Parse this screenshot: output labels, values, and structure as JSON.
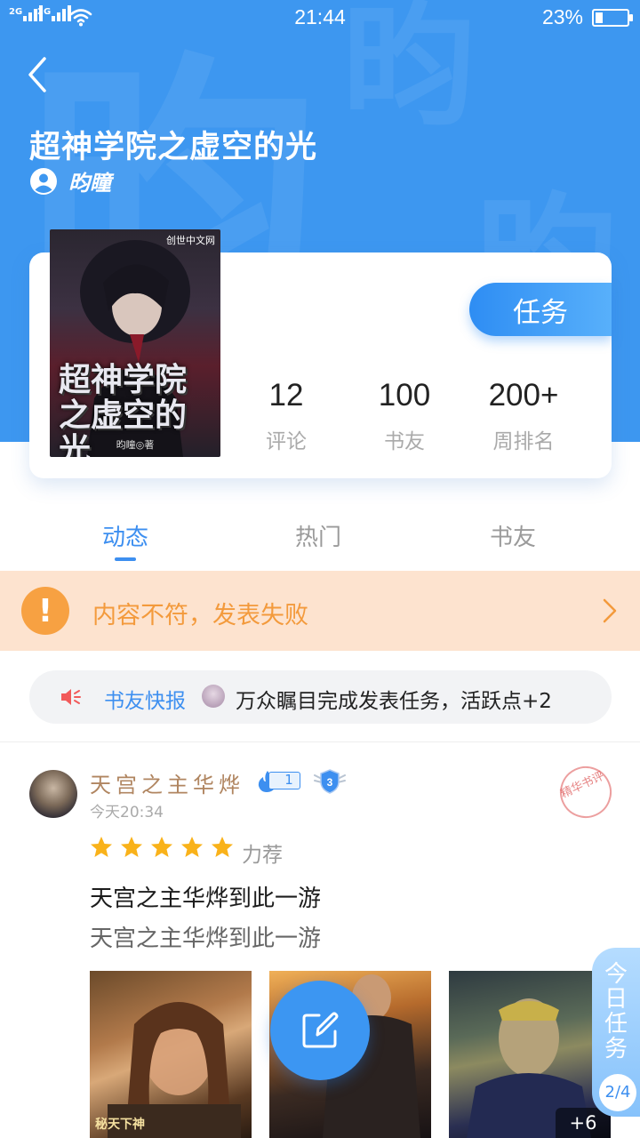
{
  "status_bar": {
    "network_1": "2G",
    "network_2": "2G",
    "time": "21:44",
    "battery_percent": "23%",
    "battery_level": 0.23
  },
  "header": {
    "watermark_char": "昀",
    "title": "超神学院之虚空的光",
    "author": "昀瞳"
  },
  "book_cover": {
    "title": "超神学院之虚空的光",
    "publisher": "创世中文网",
    "author_credit": "昀瞳◎著"
  },
  "task_button": "任务",
  "stats": [
    {
      "value": "12",
      "label": "评论"
    },
    {
      "value": "100",
      "label": "书友"
    },
    {
      "value": "200+",
      "label": "周排名"
    }
  ],
  "tabs": [
    {
      "label": "动态",
      "active": true
    },
    {
      "label": "热门",
      "active": false
    },
    {
      "label": "书友",
      "active": false
    }
  ],
  "error_banner": {
    "icon_text": "!",
    "text": "内容不符，发表失败"
  },
  "news": {
    "label": "书友快报",
    "text": "万众瞩目完成发表任务，活跃点+2"
  },
  "post": {
    "username": "天宫之主华烨",
    "level": "1",
    "rank": "3",
    "time": "今天20:34",
    "seal_text": "精华书评",
    "rating": 5,
    "rating_label": "力荐",
    "title": "天宫之主华烨到此一游",
    "body": "天宫之主华烨到此一游",
    "image_caption": "秘天下神",
    "more_images": "+6"
  },
  "daily_task": {
    "label": "今日任务",
    "progress": "2/4"
  },
  "colors": {
    "primary": "#3d97f0",
    "warning_bg": "#fde3cf",
    "warning": "#f39a3c",
    "star": "#f9b21a"
  }
}
